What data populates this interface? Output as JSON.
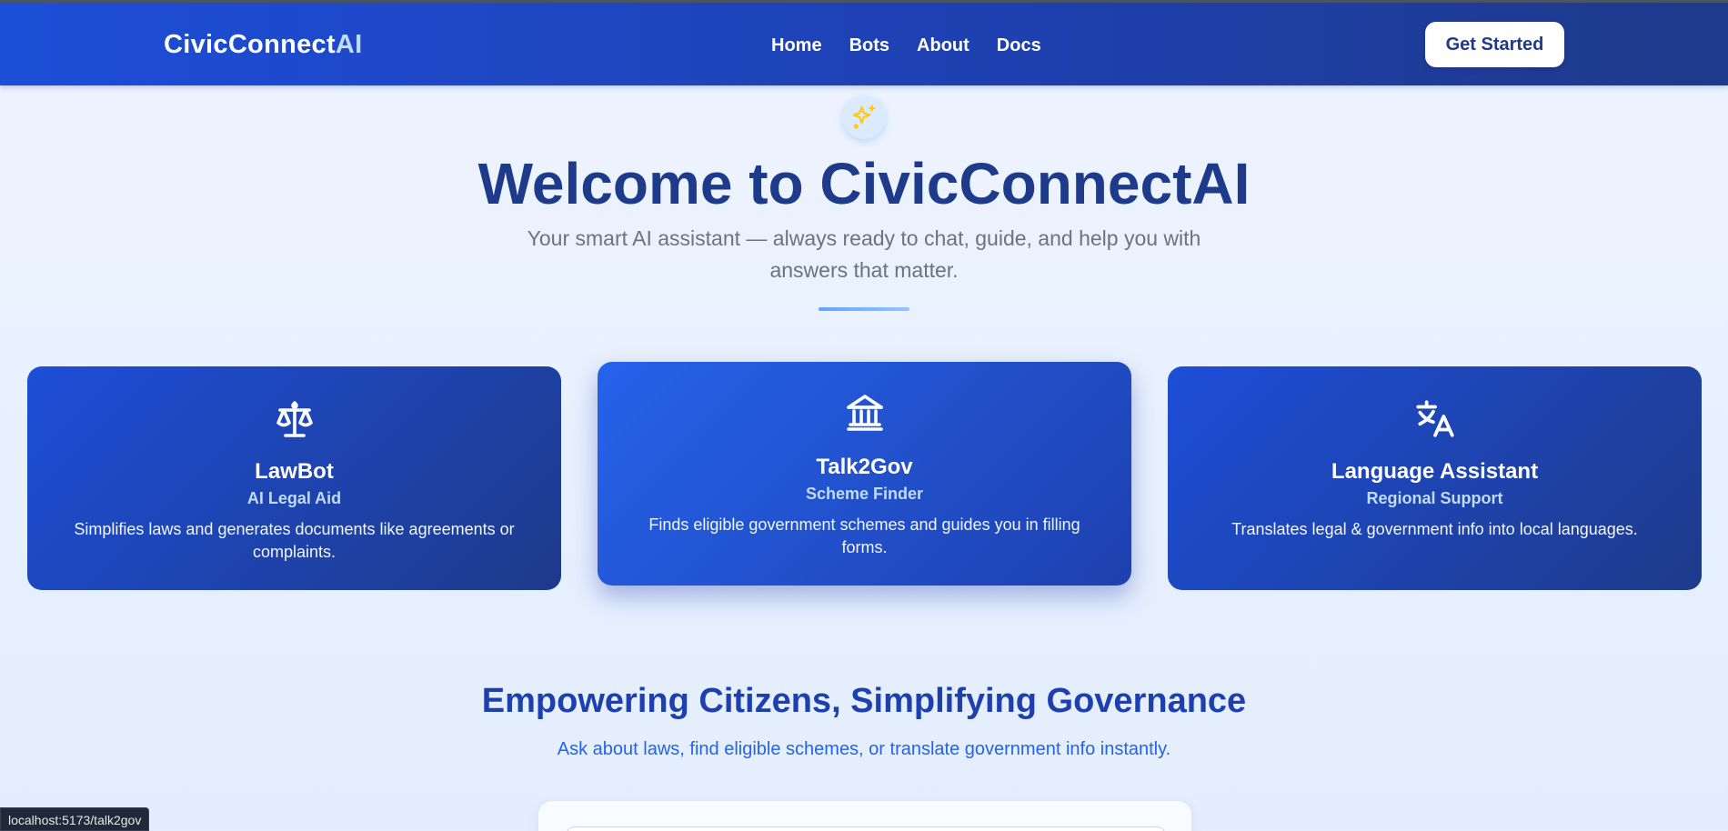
{
  "navbar": {
    "brand_main": "CivicConnect",
    "brand_ai": "AI",
    "links": [
      "Home",
      "Bots",
      "About",
      "Docs"
    ],
    "cta_label": "Get Started"
  },
  "hero": {
    "icon": "sparkles-icon",
    "title": "Welcome to CivicConnectAI",
    "subtitle": "Your smart AI assistant — always ready to chat, guide, and help you with answers that matter."
  },
  "cards": [
    {
      "icon": "scale-icon",
      "title": "LawBot",
      "subtitle": "AI Legal Aid",
      "description": "Simplifies laws and generates documents like agreements or complaints."
    },
    {
      "icon": "landmark-icon",
      "title": "Talk2Gov",
      "subtitle": "Scheme Finder",
      "description": "Finds eligible government schemes and guides you in filling forms."
    },
    {
      "icon": "translate-icon",
      "title": "Language Assistant",
      "subtitle": "Regional Support",
      "description": "Translates legal & government info into local languages."
    }
  ],
  "section": {
    "title": "Empowering Citizens, Simplifying Governance",
    "subtitle": "Ask about laws, find eligible schemes, or translate government info instantly."
  },
  "status_bar": {
    "url": "localhost:5173/talk2gov"
  },
  "colors": {
    "primary": "#1e3a8a",
    "accent": "#1d4ed8",
    "sparkle": "#facc15"
  }
}
